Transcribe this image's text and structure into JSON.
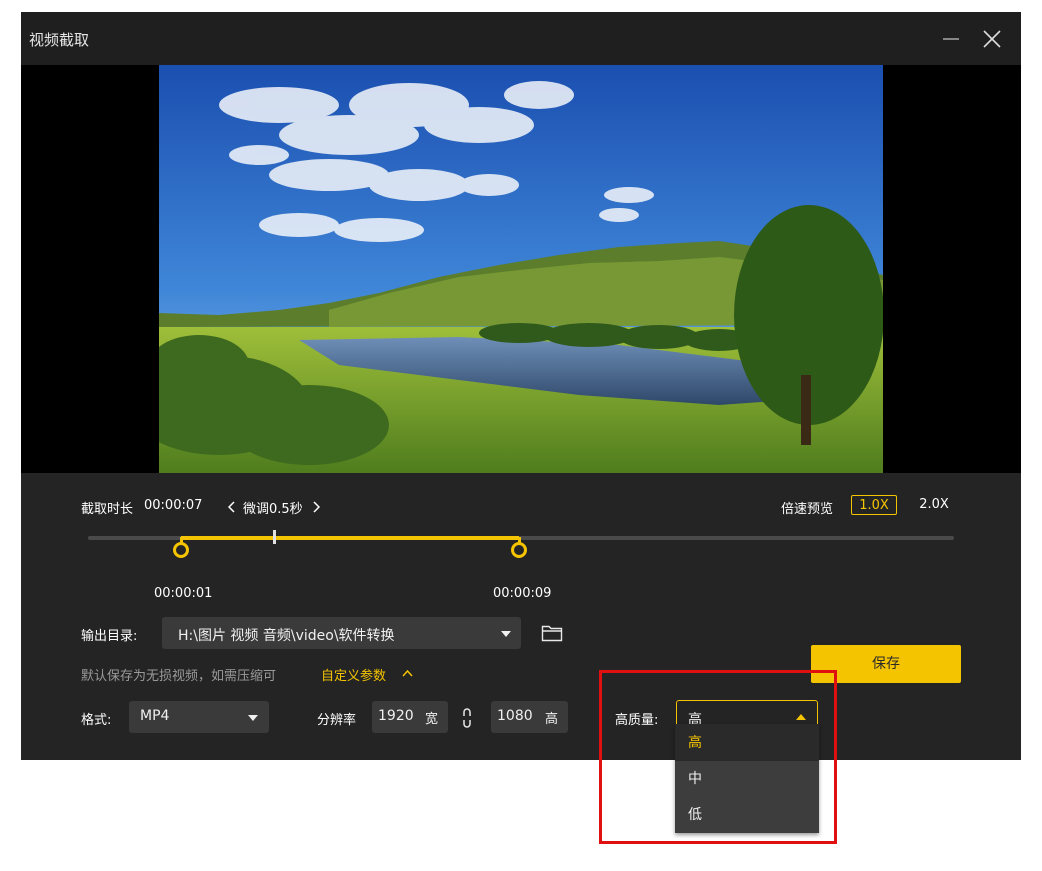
{
  "window": {
    "title": "视频截取"
  },
  "clip": {
    "duration_label": "截取时长",
    "duration_value": "00:00:07",
    "fine_tune_label": "微调0.5秒",
    "start_time": "00:00:01",
    "end_time": "00:00:09"
  },
  "speed": {
    "label": "倍速预览",
    "options": [
      "1.0X",
      "2.0X"
    ],
    "selected": "1.0X"
  },
  "output": {
    "label": "输出目录:",
    "path": "H:\\图片 视频 音频\\video\\软件转换",
    "hint": "默认保存为无损视频，如需压缩可",
    "custom_params": "自定义参数"
  },
  "format": {
    "label": "格式:",
    "value": "MP4"
  },
  "resolution": {
    "label": "分辨率",
    "width": "1920",
    "width_unit": "宽",
    "height": "1080",
    "height_unit": "高"
  },
  "quality": {
    "label": "高质量:",
    "value": "高",
    "options": [
      "高",
      "中",
      "低"
    ]
  },
  "save_label": "保存",
  "colors": {
    "accent": "#f5c400",
    "background": "#1f1f1f",
    "panel": "#242424",
    "highlight": "#e01010"
  },
  "icons": [
    "minimize-icon",
    "close-icon",
    "chevron-left-icon",
    "chevron-right-icon",
    "folder-icon",
    "link-icon",
    "chevron-up-icon",
    "caret-down-icon",
    "caret-up-icon"
  ]
}
